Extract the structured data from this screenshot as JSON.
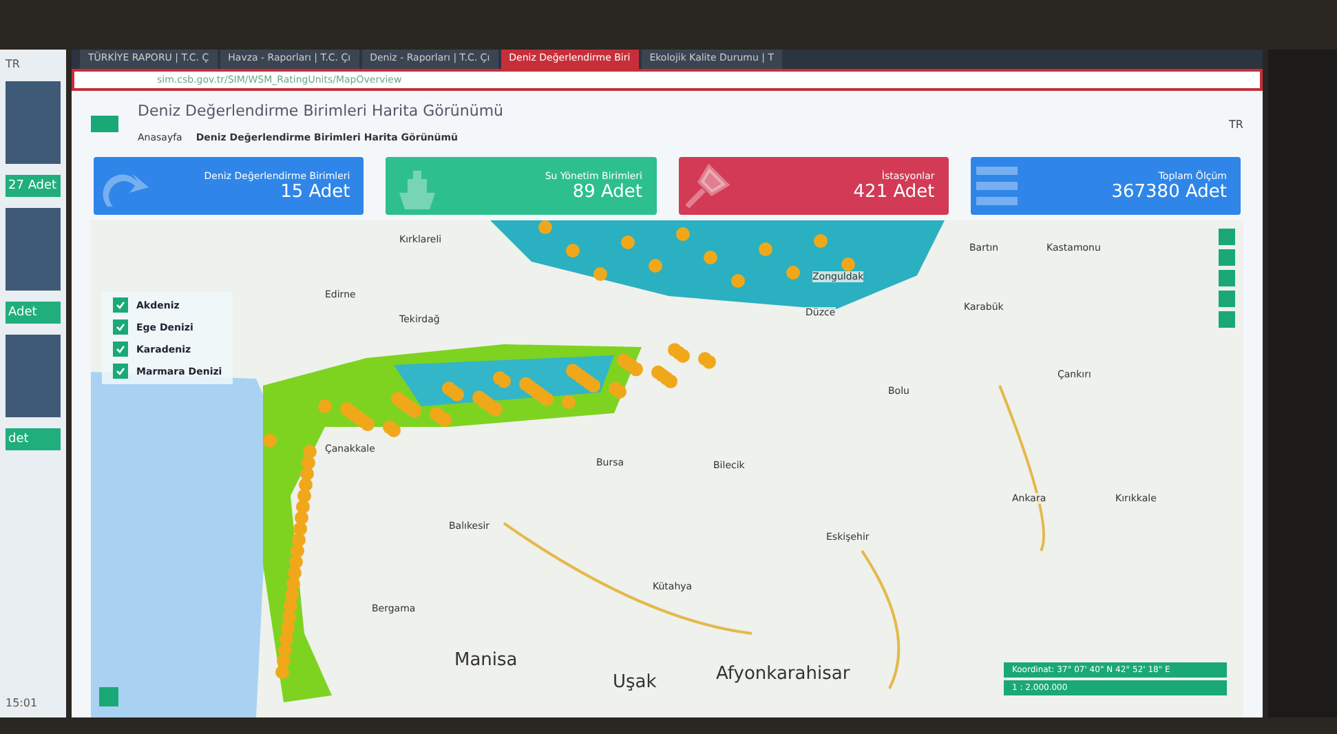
{
  "side_window": {
    "cards": [
      {
        "count": "27 Adet"
      },
      {
        "count": "Adet"
      },
      {
        "count": "det"
      }
    ],
    "language": "TR",
    "time": "15:01"
  },
  "browser": {
    "tabs": [
      {
        "label": "TÜRKİYE RAPORU | T.C. Ç",
        "selected": false
      },
      {
        "label": "Havza - Raporları | T.C. Çı",
        "selected": false
      },
      {
        "label": "Deniz - Raporları | T.C. Çı",
        "selected": false
      },
      {
        "label": "Deniz Değerlendirme Biri",
        "selected": true
      },
      {
        "label": "Ekolojik Kalite Durumu | T",
        "selected": false
      }
    ],
    "url": "sim.csb.gov.tr/SIM/WSM_RatingUnits/MapOverview"
  },
  "page": {
    "title": "Deniz Değerlendirme Birimleri Harita Görünümü",
    "breadcrumb": [
      "Anasayfa",
      "Deniz Değerlendirme Birimleri Harita Görünümü"
    ],
    "language": "TR"
  },
  "stats": [
    {
      "kind": "refresh",
      "label": "Deniz Değerlendirme Birimleri",
      "value": "15 Adet",
      "color": "#2f86e8"
    },
    {
      "kind": "ship",
      "label": "Su Yönetim Birimleri",
      "value": "89 Adet",
      "color": "#2ebf8f"
    },
    {
      "kind": "probe",
      "label": "İstasyonlar",
      "value": "421 Adet",
      "color": "#d23a55"
    },
    {
      "kind": "bars",
      "label": "Toplam Ölçüm",
      "value": "367380 Adet",
      "color": "#2f86e8"
    }
  ],
  "legend": [
    {
      "label": "Akdeniz",
      "checked": true
    },
    {
      "label": "Ege Denizi",
      "checked": true
    },
    {
      "label": "Karadeniz",
      "checked": true
    },
    {
      "label": "Marmara Denizi",
      "checked": true
    }
  ],
  "places": [
    "Kırklareli",
    "Edirne",
    "Tekirdağ",
    "Çanakkale",
    "Balıkesir",
    "Bursa",
    "Bilecik",
    "Eskişehir",
    "Kütahya",
    "Bolu",
    "Zonguldak",
    "Düzce",
    "Bartın",
    "Karabük",
    "Kastamonu",
    "Çankırı",
    "Ankara",
    "Kırıkkale",
    "Bergama",
    "Manisa",
    "Uşak",
    "Afyonkarahisar"
  ],
  "coordinates": {
    "label": "Koordinat: 37° 07' 40\" N 42° 52' 18\" E",
    "scale": "1 : 2.000.000"
  }
}
